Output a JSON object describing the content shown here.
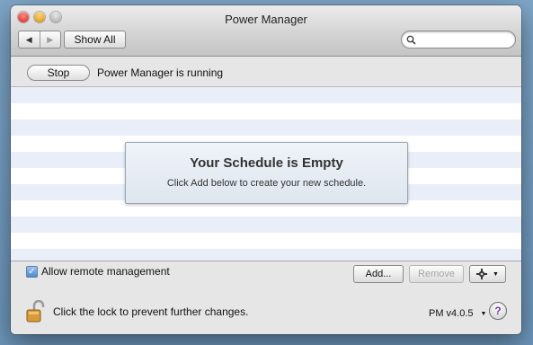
{
  "window": {
    "title": "Power Manager"
  },
  "toolbar": {
    "back_label": "◀",
    "forward_label": "▶",
    "show_all_label": "Show All",
    "search_placeholder": ""
  },
  "status": {
    "stop_label": "Stop",
    "running_text": "Power Manager is running"
  },
  "schedule": {
    "empty_title": "Your Schedule is Empty",
    "empty_subtitle": "Click Add below to create your new schedule."
  },
  "bottom": {
    "remote_checkbox_checked": true,
    "remote_label": "Allow remote management",
    "add_label": "Add...",
    "remove_label": "Remove",
    "lock_text": "Click the lock to prevent further changes.",
    "version": "PM v4.0.5",
    "help_label": "?"
  },
  "colors": {
    "stripe": "#e9eef9",
    "accent_blue": "#4f8bd8"
  }
}
